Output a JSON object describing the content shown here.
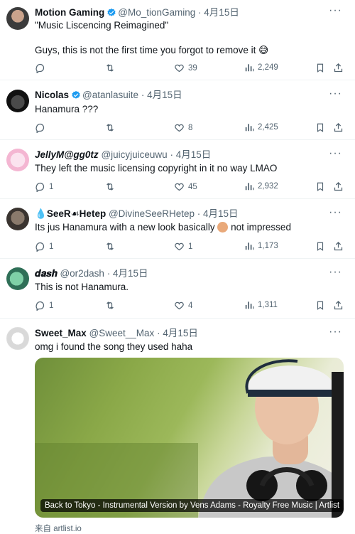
{
  "tweets": [
    {
      "name": "Motion Gaming",
      "handle": "@Mo_tionGaming",
      "time": "4月15日",
      "text": "\"Music Liscencing Reimagined\"",
      "text2": "Guys, this is not the first time you forgot to remove it 😅",
      "retweets": "",
      "likes": "39",
      "views": "2,249",
      "replies": ""
    },
    {
      "name": "Nicolas",
      "handle": "@atanlasuite",
      "time": "4月15日",
      "text": "Hanamura ???",
      "replies": "",
      "likes": "8",
      "views": "2,425"
    },
    {
      "name": "JellyM@gg0tz",
      "handle": "@juicyjuiceuwu",
      "time": "4月15日",
      "text": "They left the music licensing copyright in it no way LMAO",
      "replies": "1",
      "likes": "45",
      "views": "2,932"
    },
    {
      "name": "SeeR☙Hetep",
      "handle": "@DivineSeeRHetep",
      "time": "4月15日",
      "text": "Its jus Hanamura with a new look basically",
      "text_end": "not impressed",
      "replies": "1",
      "likes": "1",
      "views": "1,173"
    },
    {
      "name": "𝒅𝒂𝒔𝒉",
      "handle": "@or2dash",
      "time": "4月15日",
      "text": "This is not Hanamura.",
      "replies": "1",
      "likes": "4",
      "views": "1,311"
    },
    {
      "name": "Sweet_Max",
      "handle": "@Sweet__Max",
      "time": "4月15日",
      "text": "omg i found the song they used haha",
      "media_caption": "Back to Tokyo - Instrumental Version by Vens Adams - Royalty Free Music | Artlist",
      "source": "来自 artlist.io"
    }
  ],
  "ui": {
    "dot": "·",
    "more": "···",
    "accent": "#1d9bf0",
    "muted": "#536471",
    "icons": [
      "reply-icon",
      "retweet-icon",
      "like-icon",
      "views-icon",
      "bookmark-icon",
      "share-icon"
    ]
  }
}
